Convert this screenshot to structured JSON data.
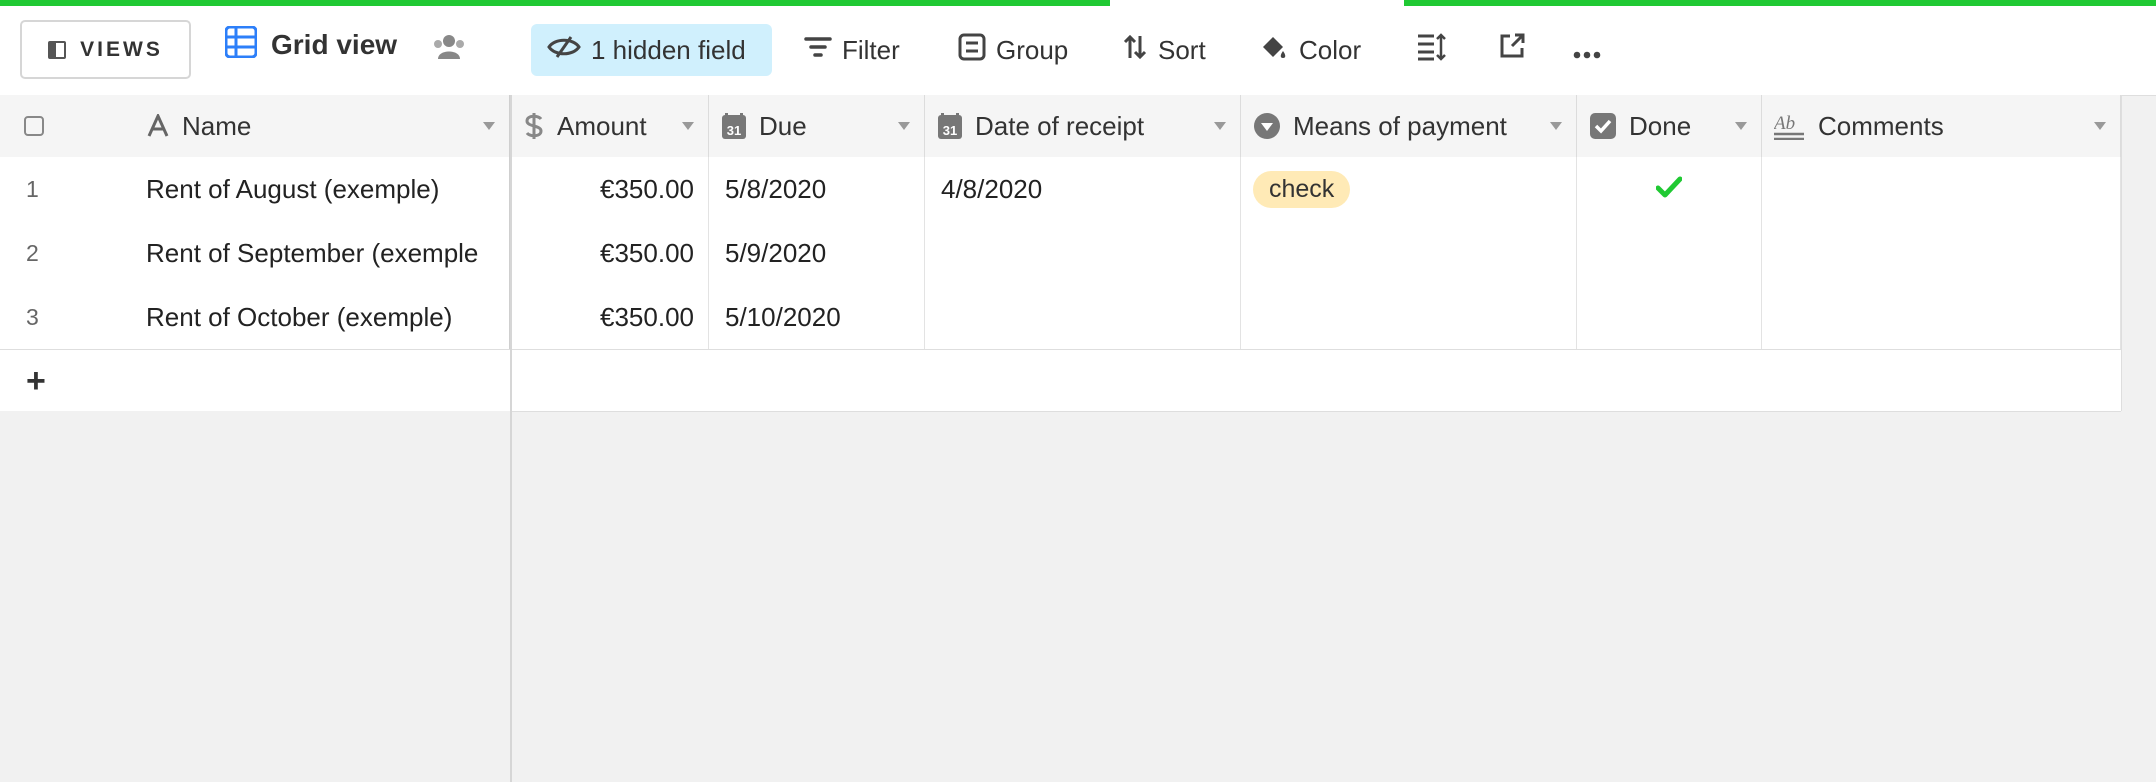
{
  "colors": {
    "accent": "#20c933",
    "active_button_bg": "#d0f0fd",
    "pill_bg": "#ffeab6",
    "check_green": "#20c933",
    "grid_view_blue": "#2d7ff9"
  },
  "toolbar": {
    "views_label": "VIEWS",
    "view_name": "Grid view",
    "hidden_fields_label": "1 hidden field",
    "filter_label": "Filter",
    "group_label": "Group",
    "sort_label": "Sort",
    "color_label": "Color",
    "icons": [
      "sidebar-icon",
      "grid-view-icon",
      "collaborators-icon",
      "hide-fields-icon",
      "filter-icon",
      "group-icon",
      "sort-icon",
      "color-icon",
      "row-height-icon",
      "share-view-icon",
      "more-icon"
    ]
  },
  "table": {
    "columns": [
      {
        "label": "Name",
        "icon": "text-field-icon"
      },
      {
        "label": "Amount",
        "icon": "currency-field-icon"
      },
      {
        "label": "Due",
        "icon": "date-field-icon"
      },
      {
        "label": "Date of receipt",
        "icon": "date-field-icon"
      },
      {
        "label": "Means of payment",
        "icon": "single-select-field-icon"
      },
      {
        "label": "Done",
        "icon": "checkbox-field-icon"
      },
      {
        "label": "Comments",
        "icon": "long-text-field-icon"
      }
    ],
    "rows": [
      {
        "num": "1",
        "name": "Rent of August (exemple)",
        "amount": "€350.00",
        "due": "5/8/2020",
        "receipt": "4/8/2020",
        "payment": "check",
        "done": true,
        "comments": ""
      },
      {
        "num": "2",
        "name": "Rent of September (exemple",
        "amount": "€350.00",
        "due": "5/9/2020",
        "receipt": "",
        "payment": "",
        "done": false,
        "comments": ""
      },
      {
        "num": "3",
        "name": "Rent of October (exemple)",
        "amount": "€350.00",
        "due": "5/10/2020",
        "receipt": "",
        "payment": "",
        "done": false,
        "comments": ""
      }
    ],
    "add_row_label": "+"
  }
}
